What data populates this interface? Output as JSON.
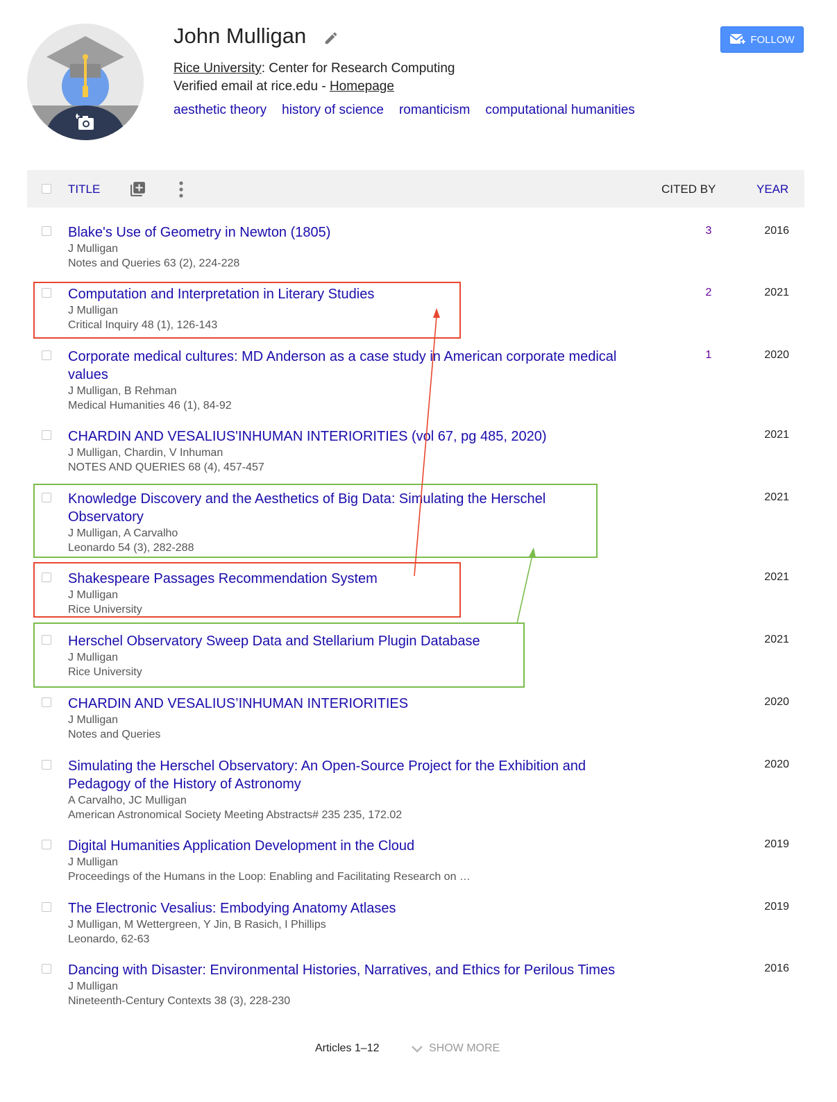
{
  "profile": {
    "name": "John Mulligan",
    "affiliation_link": "Rice University",
    "affiliation_rest": ": Center for Research Computing",
    "email_prefix": "Verified email at rice.edu - ",
    "homepage": "Homepage",
    "interests": [
      "aesthetic theory",
      "history of science",
      "romanticism",
      "computational humanities"
    ],
    "follow_label": "FOLLOW"
  },
  "table": {
    "title_header": "TITLE",
    "cited_header": "CITED BY",
    "year_header": "YEAR"
  },
  "articles": [
    {
      "title": "Blake's Use of Geometry in Newton (1805)",
      "authors": "J Mulligan",
      "venue": "Notes and Queries 63 (2), 224-228",
      "cited": "3",
      "year": "2016"
    },
    {
      "title": "Computation and Interpretation in Literary Studies",
      "authors": "J Mulligan",
      "venue": "Critical Inquiry 48 (1), 126-143",
      "cited": "2",
      "year": "2021"
    },
    {
      "title": "Corporate medical cultures: MD Anderson as a case study in American corporate medical values",
      "authors": "J Mulligan, B Rehman",
      "venue": "Medical Humanities 46 (1), 84-92",
      "cited": "1",
      "year": "2020"
    },
    {
      "title": "CHARDIN AND VESALIUS'INHUMAN INTERIORITIES (vol 67, pg 485, 2020)",
      "authors": "J Mulligan, Chardin, V Inhuman",
      "venue": "NOTES AND QUERIES 68 (4), 457-457",
      "cited": "",
      "year": "2021"
    },
    {
      "title": "Knowledge Discovery and the Aesthetics of Big Data: Simulating the Herschel Observatory",
      "authors": "J Mulligan, A Carvalho",
      "venue": "Leonardo 54 (3), 282-288",
      "cited": "",
      "year": "2021"
    },
    {
      "title": "Shakespeare Passages Recommendation System",
      "authors": "J Mulligan",
      "venue": "Rice University",
      "cited": "",
      "year": "2021"
    },
    {
      "title": "Herschel Observatory Sweep Data and Stellarium Plugin Database",
      "authors": "J Mulligan",
      "venue": "Rice University",
      "cited": "",
      "year": "2021"
    },
    {
      "title": "CHARDIN AND VESALIUS’INHUMAN INTERIORITIES",
      "authors": "J Mulligan",
      "venue": "Notes and Queries",
      "cited": "",
      "year": "2020"
    },
    {
      "title": "Simulating the Herschel Observatory: An Open-Source Project for the Exhibition and Pedagogy of the History of Astronomy",
      "authors": "A Carvalho, JC Mulligan",
      "venue": "American Astronomical Society Meeting Abstracts# 235 235, 172.02",
      "cited": "",
      "year": "2020"
    },
    {
      "title": "Digital Humanities Application Development in the Cloud",
      "authors": "J Mulligan",
      "venue": "Proceedings of the Humans in the Loop: Enabling and Facilitating Research on …",
      "cited": "",
      "year": "2019"
    },
    {
      "title": "The Electronic Vesalius: Embodying Anatomy Atlases",
      "authors": "J Mulligan, M Wettergreen, Y Jin, B Rasich, I Phillips",
      "venue": "Leonardo, 62-63",
      "cited": "",
      "year": "2019"
    },
    {
      "title": "Dancing with Disaster: Environmental Histories, Narratives, and Ethics for Perilous Times",
      "authors": "J Mulligan",
      "venue": "Nineteenth-Century Contexts 38 (3), 228-230",
      "cited": "",
      "year": "2016"
    }
  ],
  "footer": {
    "articles_range": "Articles 1–12",
    "show_more": "SHOW MORE"
  },
  "colors": {
    "link": "#1a0dab",
    "annotation_red": "#e8472f",
    "annotation_green": "#7bbd4d",
    "follow_button": "#4d90fe"
  }
}
